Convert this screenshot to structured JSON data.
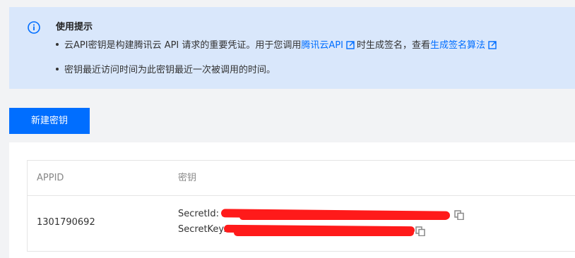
{
  "notice": {
    "title": "使用提示",
    "line1_text_a": "云API密钥是构建腾讯云 API 请求的重要凭证。用于您调用",
    "line1_link1": "腾讯云API",
    "line1_text_b": "时生成签名，查看",
    "line1_link2": "生成签名算法",
    "line2_text": "密钥最近访问时间为此密钥最近一次被调用的时间。",
    "icon": "info-circle-icon"
  },
  "toolbar": {
    "create_label": "新建密钥"
  },
  "table": {
    "headers": [
      "APPID",
      "密钥"
    ],
    "rows": [
      {
        "appid": "1301790692",
        "secret_id_label": "SecretId: AK",
        "secret_key_label": "SecretKey: Tu"
      }
    ]
  },
  "colors": {
    "accent": "#006eff",
    "notice_bg": "#d9e7fb",
    "redaction": "#ff1a1a"
  }
}
